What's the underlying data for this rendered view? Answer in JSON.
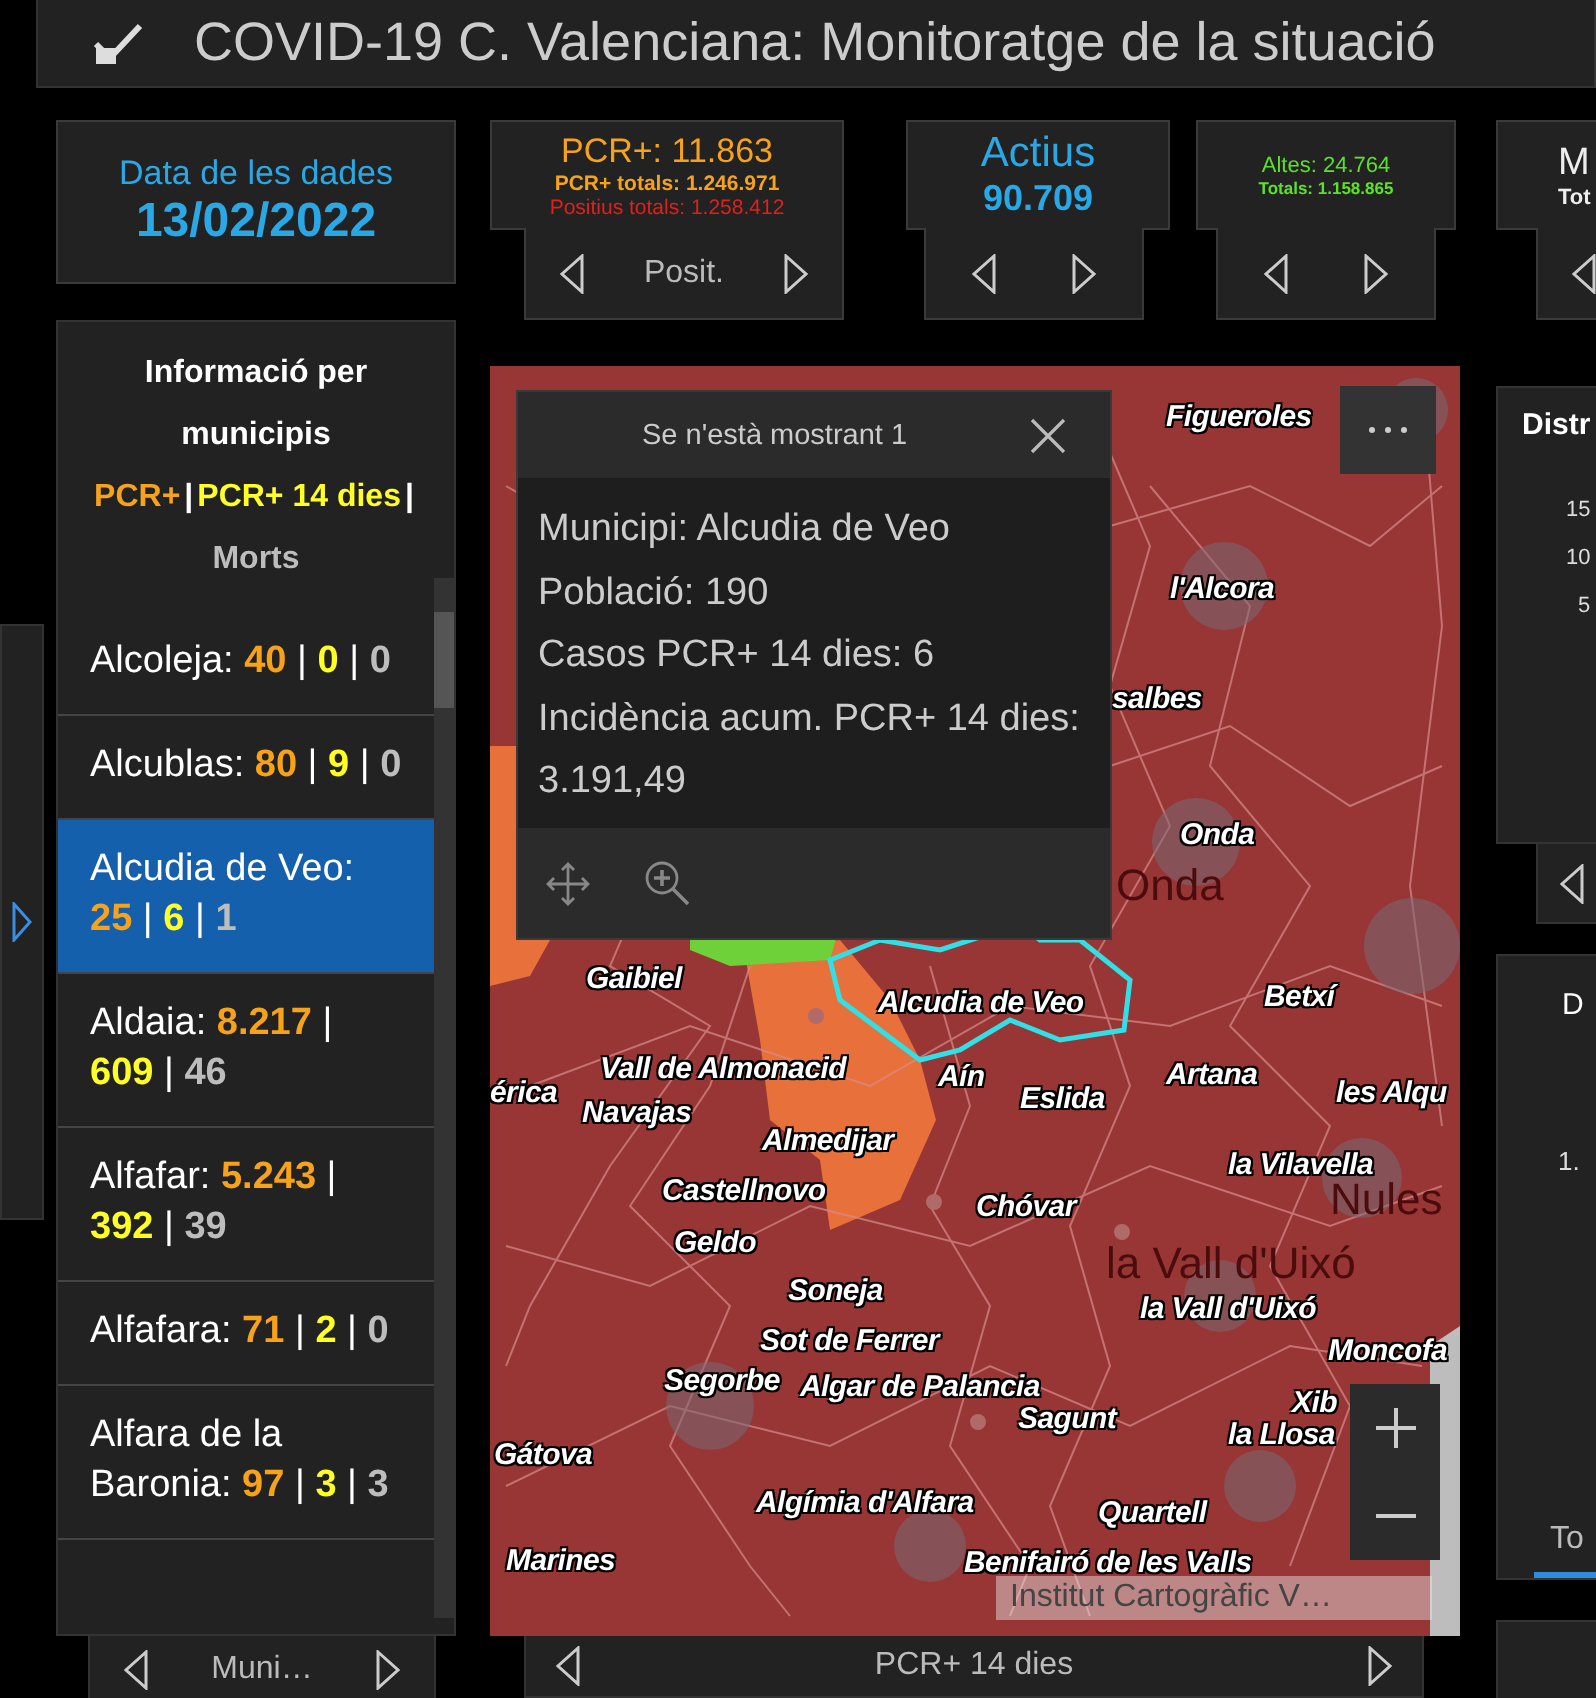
{
  "header": {
    "title": "COVID-19 C. Valenciana: Monitoratge de la situació"
  },
  "kpis": [
    {
      "kind": "date",
      "label": "Data de les dades",
      "value": "13/02/2022",
      "nav": false
    },
    {
      "kind": "pcr",
      "label": "PCR+: 11.863",
      "line_1": "PCR+ totals: 1.246.971",
      "line_2": "Positius totals: 1.258.412",
      "nav": true,
      "nav_label": "Posit."
    },
    {
      "kind": "big",
      "label": "Actius",
      "value": "90.709",
      "nav": true
    },
    {
      "kind": "small",
      "line_1": "Altes: 24.764",
      "line_2": "Totals: 1.158.865",
      "nav": true
    },
    {
      "kind": "cut",
      "label": "M",
      "line_1": "Tot",
      "nav": true
    }
  ],
  "municipalities": {
    "title": "Informació per municipis",
    "separator": "|",
    "legend": [
      {
        "text": "PCR+",
        "color": "#f7a21b"
      },
      {
        "text": "PCR+ 14 dies",
        "color": "#ffff26"
      },
      {
        "text": "Morts",
        "color": "#bdbdbd"
      }
    ],
    "rows": [
      {
        "name": "Alcoleja:",
        "pcr": "40",
        "pcr_14": "0",
        "deaths": "0",
        "selected": false
      },
      {
        "name": "Alcublas:",
        "pcr": "80",
        "pcr_14": "9",
        "deaths": "0",
        "selected": false
      },
      {
        "name": "Alcudia de Veo:",
        "pcr": "25",
        "pcr_14": "6",
        "deaths": "1",
        "selected": true
      },
      {
        "name": "Aldaia:",
        "pcr": "8.217",
        "pcr_14": "609",
        "deaths": "46",
        "selected": false
      },
      {
        "name": "Alfafar:",
        "pcr": "5.243",
        "pcr_14": "392",
        "deaths": "39",
        "selected": false
      },
      {
        "name": "Alfafara:",
        "pcr": "71",
        "pcr_14": "2",
        "deaths": "0",
        "selected": false
      },
      {
        "name": "Alfara de la Baronia:",
        "pcr": "97",
        "pcr_14": "3",
        "deaths": "3",
        "selected": false
      }
    ],
    "nav_label": "Muni…"
  },
  "map": {
    "labels": [
      {
        "text": "Figueroles",
        "kind": "place"
      },
      {
        "text": "l'Alcora",
        "kind": "place"
      },
      {
        "text": "salbes",
        "kind": "place"
      },
      {
        "text": "Onda",
        "kind": "place"
      },
      {
        "text": "Onda",
        "kind": "basemap"
      },
      {
        "text": "Gaibiel",
        "kind": "place"
      },
      {
        "text": "Alcudia de Veo",
        "kind": "place"
      },
      {
        "text": "Betxí",
        "kind": "place"
      },
      {
        "text": "érica",
        "kind": "place"
      },
      {
        "text": "Vall de Almonacid",
        "kind": "place"
      },
      {
        "text": "Navajas",
        "kind": "place"
      },
      {
        "text": "Aín",
        "kind": "place"
      },
      {
        "text": "Eslida",
        "kind": "place"
      },
      {
        "text": "Artana",
        "kind": "place"
      },
      {
        "text": "les Alqu",
        "kind": "place"
      },
      {
        "text": "Almedijar",
        "kind": "place"
      },
      {
        "text": "la Vilavella",
        "kind": "place"
      },
      {
        "text": "Castellnovo",
        "kind": "place"
      },
      {
        "text": "Chóvar",
        "kind": "place"
      },
      {
        "text": "Nules",
        "kind": "basemap"
      },
      {
        "text": "Geldo",
        "kind": "place"
      },
      {
        "text": "la Vall d'Uixó",
        "kind": "basemap"
      },
      {
        "text": "Soneja",
        "kind": "place"
      },
      {
        "text": "la Vall d'Uixó",
        "kind": "place"
      },
      {
        "text": "Sot de Ferrer",
        "kind": "place"
      },
      {
        "text": "Moncofa",
        "kind": "place"
      },
      {
        "text": "Segorbe",
        "kind": "place"
      },
      {
        "text": "Algar de Palancia",
        "kind": "place"
      },
      {
        "text": "Xib",
        "kind": "place"
      },
      {
        "text": "Sagunt",
        "kind": "place"
      },
      {
        "text": "la Llosa",
        "kind": "place"
      },
      {
        "text": "Gátova",
        "kind": "place"
      },
      {
        "text": "Algímia d'Alfara",
        "kind": "place"
      },
      {
        "text": "Quartell",
        "kind": "place"
      },
      {
        "text": "Marines",
        "kind": "place"
      },
      {
        "text": "Benifairó de les Valls",
        "kind": "place"
      }
    ],
    "popup": {
      "title": "Se n'està mostrant 1",
      "lines": [
        "Municipi: Alcudia de Veo",
        "Població: 190",
        "Casos PCR+ 14 dies: 6",
        "Incidència acum. PCR+ 14 dies: 3.191,49"
      ]
    },
    "attribution": "Institut Cartogràfic V…",
    "nav_label": "PCR+ 14 dies"
  },
  "right_panels": [
    {
      "kind": "chart",
      "title": "Distr",
      "ticks": [
        "15",
        "10",
        "5"
      ]
    },
    {
      "kind": "stat",
      "title": "D",
      "value": "1.",
      "tab": "To"
    }
  ]
}
